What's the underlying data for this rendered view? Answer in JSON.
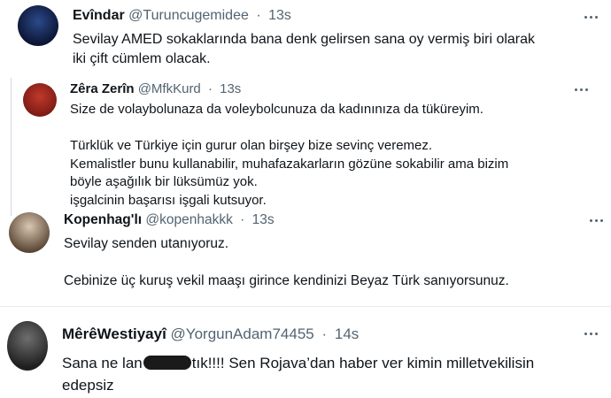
{
  "tweets": [
    {
      "name": "Evîndar",
      "handle": "@Turuncugemidee",
      "time": "13s",
      "lines": [
        "Sevilay AMED sokaklarında bana denk gelirsen sana oy vermiş biri olarak",
        "iki çift cümlem olacak."
      ]
    },
    {
      "name": "Kopenhag'lı",
      "handle": "@kopenhakkk",
      "time": "13s",
      "lines": [
        "Sevilay senden utanıyoruz.",
        "",
        "Cebinize üç kuruş vekil maaşı girince kendinizi Beyaz Türk sanıyorsunuz."
      ]
    },
    {
      "name": "MêrêWestiyayî",
      "handle": "@YorgunAdam74455",
      "time": "14s",
      "line1_before": "Sana ne lan",
      "line1_partial": "tık",
      "line1_after": "!!!! Sen Rojava’dan haber ver kimin milletvekilisin",
      "line2": "edepsiz"
    }
  ],
  "quoted": {
    "name": "Zêra Zerîn",
    "handle": "@MfkKurd",
    "time": "13s",
    "lines": [
      "Size de volaybolunaza da voleybolcunuza da kadınınıza da tüküreyim.",
      "",
      "Türklük ve Türkiye için gurur olan birşey bize sevinç veremez.",
      "Kemalistler bunu kullanabilir, muhafazakarların gözüne sokabilir ama bizim",
      "böyle aşağılık bir lüksümüz yok.",
      "işgalcinin başarısı işgali kutsuyor."
    ]
  },
  "icons": {
    "more": "more-horizontal-icon"
  },
  "colors": {
    "text": "#0f1419",
    "secondary": "#536471",
    "border": "#e6ecf0"
  }
}
